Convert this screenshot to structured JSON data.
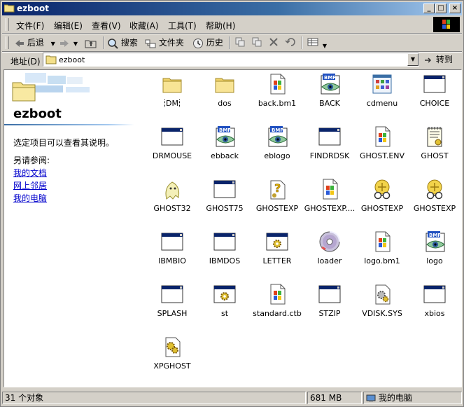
{
  "window": {
    "title": "ezboot"
  },
  "title_buttons": {
    "minimize": "_",
    "maximize": "□",
    "close": "×"
  },
  "menu": [
    "文件(F)",
    "编辑(E)",
    "查看(V)",
    "收藏(A)",
    "工具(T)",
    "帮助(H)"
  ],
  "toolbar": {
    "back": "后退",
    "search": "搜索",
    "folders": "文件夹",
    "history": "历史"
  },
  "address": {
    "label": "地址(D)",
    "value": "ezboot",
    "go": "转到"
  },
  "leftpane": {
    "title": "ezboot",
    "hint": "选定项目可以查看其说明。",
    "see_also": "另请参阅:",
    "links": [
      "我的文档",
      "网上邻居",
      "我的电脑"
    ]
  },
  "files": [
    {
      "name": "DM",
      "icon": "folder-icon",
      "selected": true
    },
    {
      "name": "dos",
      "icon": "folder-icon"
    },
    {
      "name": "back.bm1",
      "icon": "windows-file-icon"
    },
    {
      "name": "BACK",
      "icon": "bmp-image-icon"
    },
    {
      "name": "cdmenu",
      "icon": "app-grid-icon"
    },
    {
      "name": "CHOICE",
      "icon": "dos-window-icon"
    },
    {
      "name": "DRMOUSE",
      "icon": "dos-window-icon"
    },
    {
      "name": "ebback",
      "icon": "bmp-image-icon"
    },
    {
      "name": "eblogo",
      "icon": "bmp-image-icon"
    },
    {
      "name": "FINDRDSK",
      "icon": "dos-window-icon"
    },
    {
      "name": "GHOST.ENV",
      "icon": "windows-file-icon"
    },
    {
      "name": "GHOST",
      "icon": "config-notepad-icon"
    },
    {
      "name": "GHOST32",
      "icon": "ghost-icon"
    },
    {
      "name": "GHOST75",
      "icon": "dos-window-icon"
    },
    {
      "name": "GHOSTEXP",
      "icon": "help-file-icon"
    },
    {
      "name": "GHOSTEXP....",
      "icon": "windows-file-icon"
    },
    {
      "name": "GHOSTEXP",
      "icon": "ghost-explorer-icon"
    },
    {
      "name": "GHOSTEXP",
      "icon": "ghost-explorer-icon"
    },
    {
      "name": "IBMBIO",
      "icon": "dos-window-icon"
    },
    {
      "name": "IBMDOS",
      "icon": "dos-window-icon"
    },
    {
      "name": "LETTER",
      "icon": "gear-window-icon"
    },
    {
      "name": "loader",
      "icon": "cd-disc-icon"
    },
    {
      "name": "logo.bm1",
      "icon": "windows-file-icon"
    },
    {
      "name": "logo",
      "icon": "bmp-image-icon"
    },
    {
      "name": "SPLASH",
      "icon": "dos-window-icon"
    },
    {
      "name": "st",
      "icon": "gear-window-icon"
    },
    {
      "name": "standard.ctb",
      "icon": "windows-file-icon"
    },
    {
      "name": "STZIP",
      "icon": "dos-window-icon"
    },
    {
      "name": "VDISK.SYS",
      "icon": "system-file-icon"
    },
    {
      "name": "xbios",
      "icon": "dos-window-icon"
    },
    {
      "name": "XPGHOST",
      "icon": "gear-file-icon"
    }
  ],
  "status": {
    "count": "31 个对象",
    "size": "681 MB",
    "location": "我的电脑"
  }
}
